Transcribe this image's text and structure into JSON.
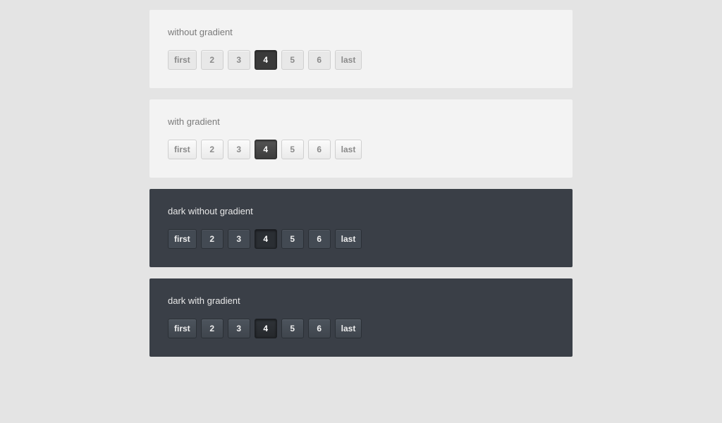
{
  "sections": {
    "s1": {
      "title": "without gradient"
    },
    "s2": {
      "title": "with gradient"
    },
    "s3": {
      "title": "dark without gradient"
    },
    "s4": {
      "title": "dark with gradient"
    }
  },
  "pager": {
    "first": "first",
    "p2": "2",
    "p3": "3",
    "p4": "4",
    "p5": "5",
    "p6": "6",
    "last": "last"
  },
  "active": "4"
}
